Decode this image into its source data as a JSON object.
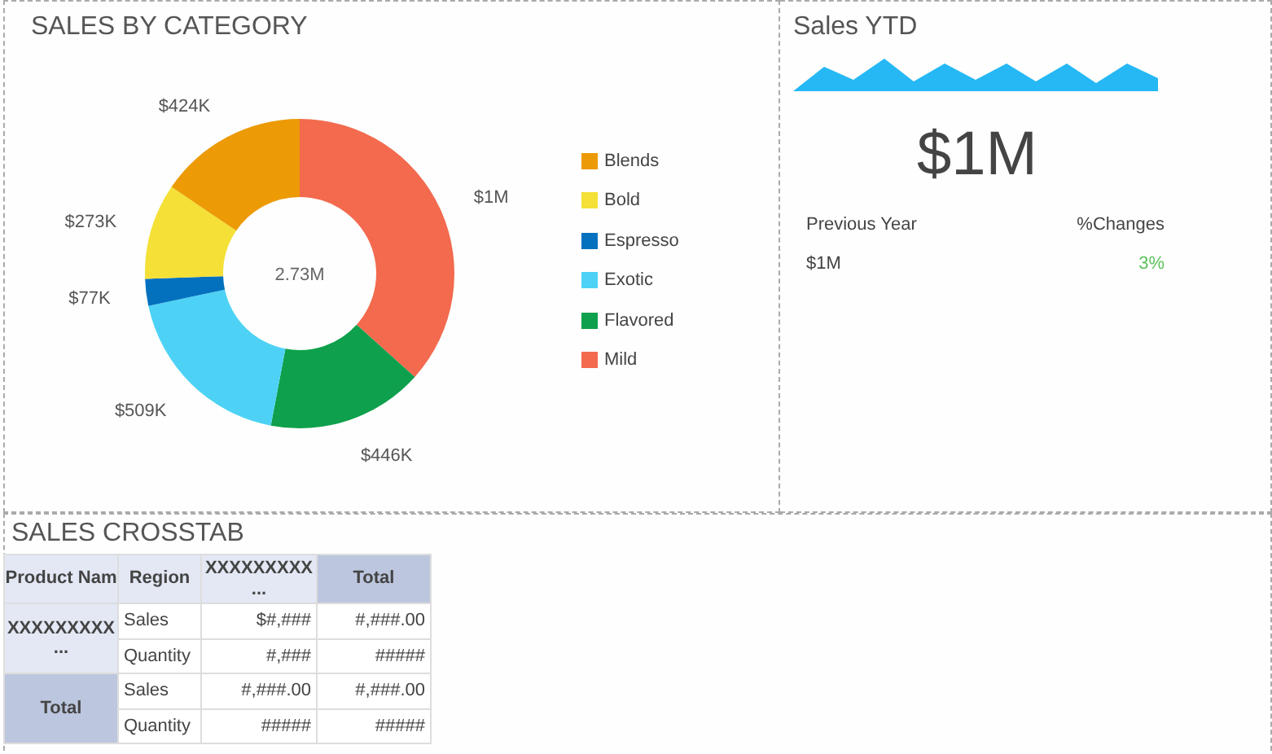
{
  "category_panel": {
    "title": "SALES BY CATEGORY",
    "chart_data": {
      "type": "donut",
      "categories": [
        "Blends",
        "Bold",
        "Espresso",
        "Exotic",
        "Flavored",
        "Mild"
      ],
      "values": [
        424000,
        273000,
        77000,
        509000,
        446000,
        1000000
      ],
      "legend": "right",
      "colors": [
        "#ec9a05",
        "#f4e037",
        "#0471bf",
        "#4dd2f5",
        "#0ea04c",
        "#f36a4e"
      ],
      "value_labels": [
        "$424K",
        "$273K",
        "$77K",
        "$509K",
        "$446K",
        "$1M"
      ],
      "annotations": [
        "2.73M"
      ]
    }
  },
  "ytd_panel": {
    "title": "Sales YTD",
    "value": "$1M",
    "previous_label": "Previous Year",
    "change_label": "%Changes",
    "previous_value": "$1M",
    "change_value": "3%"
  },
  "crosstab_panel": {
    "title": "SALES CROSSTAB",
    "columns": [
      {
        "label": "Product Nam",
        "kind": "dim"
      },
      {
        "label": "Region",
        "kind": "dim"
      },
      {
        "label": "XXXXXXXXX ...",
        "kind": "dim"
      },
      {
        "label": "Total",
        "kind": "total"
      }
    ],
    "groups": [
      {
        "label": "XXXXXXXXX ...",
        "kind": "member",
        "rows": [
          {
            "measure": "Sales",
            "values": [
              "$#,###",
              "#,###.00"
            ]
          },
          {
            "measure": "Quantity",
            "values": [
              "#,###",
              "#####"
            ]
          }
        ]
      },
      {
        "label": "Total",
        "kind": "total",
        "rows": [
          {
            "measure": "Sales",
            "values": [
              "#,###.00",
              "#,###.00"
            ]
          },
          {
            "measure": "Quantity",
            "values": [
              "#####",
              "#####"
            ]
          }
        ]
      }
    ]
  }
}
